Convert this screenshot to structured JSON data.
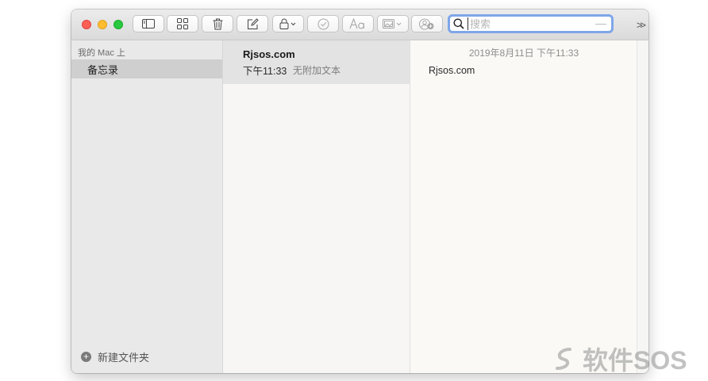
{
  "toolbar": {
    "search_placeholder": "搜索",
    "overflow_label": ">>"
  },
  "sidebar": {
    "header": "我的 Mac 上",
    "folders": [
      {
        "label": "备忘录",
        "selected": true
      }
    ],
    "new_folder_label": "新建文件夹"
  },
  "note_list": {
    "notes": [
      {
        "title": "Rjsos.com",
        "time": "下午11:33",
        "preview": "无附加文本"
      }
    ]
  },
  "editor": {
    "date": "2019年8月11日 下午11:33",
    "body": "Rjsos.com"
  },
  "watermark": {
    "text": "软件SOS"
  },
  "colors": {
    "close": "#fe5f57",
    "minimize": "#febc2e",
    "zoom": "#28c840",
    "search_focus": "#7ea6e8",
    "sidebar_selection": "#cfcfcf"
  }
}
